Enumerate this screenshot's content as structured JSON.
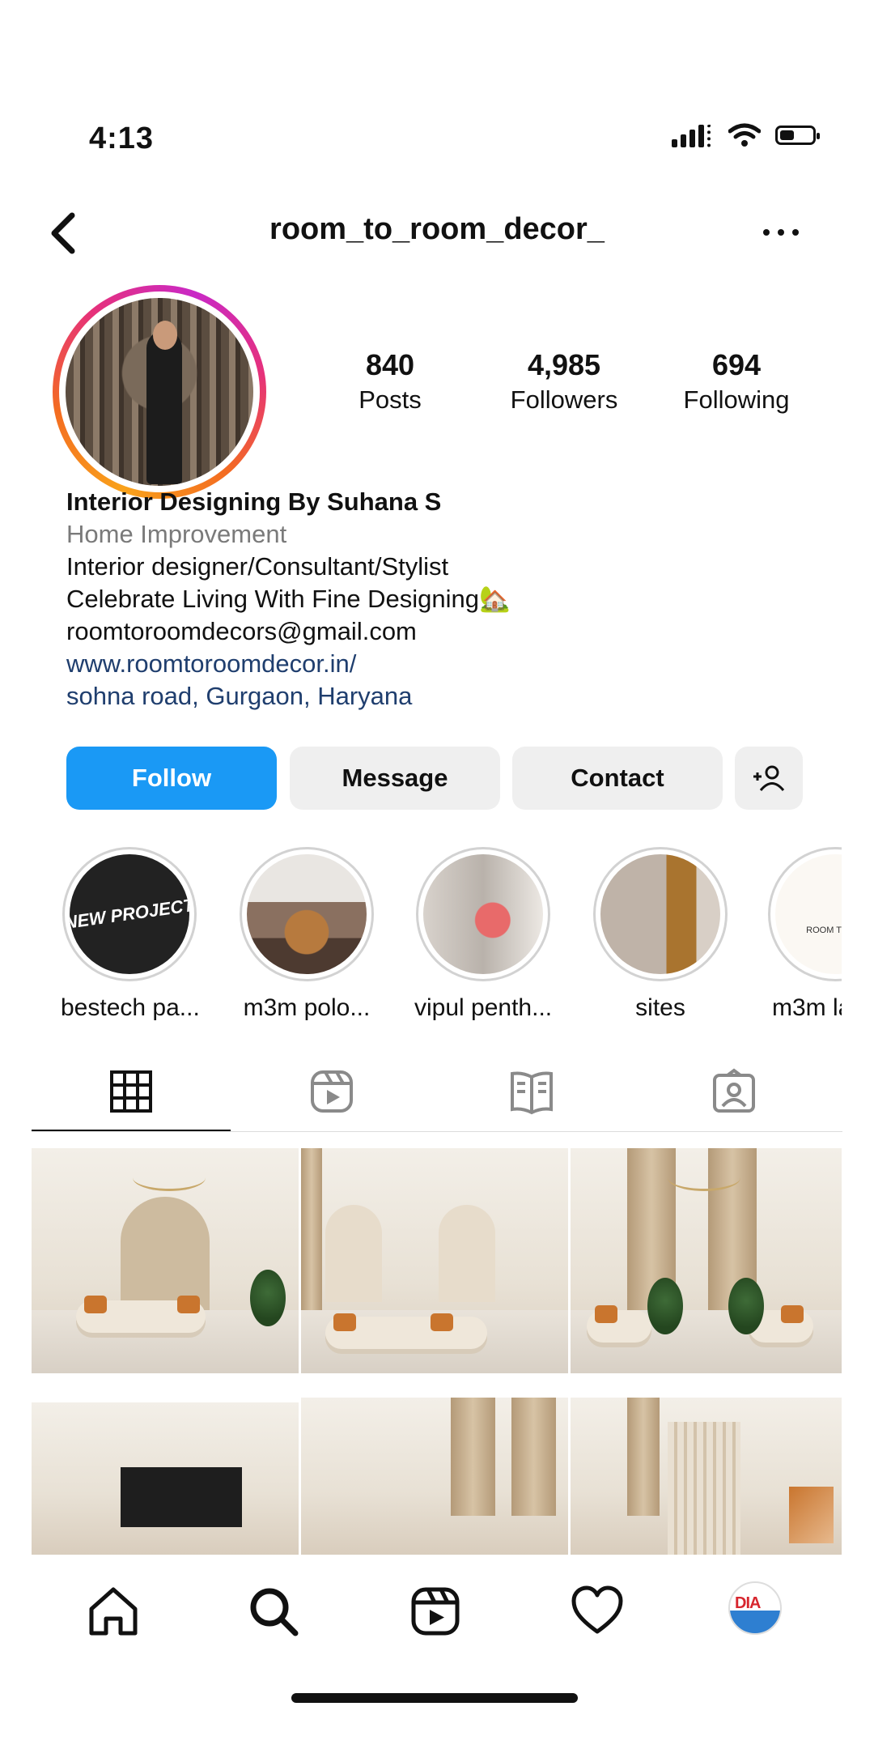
{
  "status_bar": {
    "time": "4:13",
    "battery_level": 0.45
  },
  "header": {
    "username": "room_to_room_decor_"
  },
  "stats": {
    "posts": {
      "count": "840",
      "label": "Posts"
    },
    "followers": {
      "count": "4,985",
      "label": "Followers"
    },
    "following": {
      "count": "694",
      "label": "Following"
    }
  },
  "bio": {
    "name": "Interior Designing By Suhana S",
    "category": "Home Improvement",
    "line1": "Interior designer/Consultant/Stylist",
    "line2": "Celebrate Living With Fine Designing🏡",
    "email": "roomtoroomdecors@gmail.com",
    "website": "www.roomtoroomdecor.in/",
    "location": "sohna road, Gurgaon, Haryana"
  },
  "actions": {
    "follow": "Follow",
    "message": "Message",
    "contact": "Contact"
  },
  "highlights": [
    {
      "label": "bestech pa...",
      "image_text": "NEW PROJECT"
    },
    {
      "label": "m3m polo..."
    },
    {
      "label": "vipul penth..."
    },
    {
      "label": "sites"
    },
    {
      "label": "m3m la",
      "image_text": "ROOM TO RO"
    }
  ],
  "colors": {
    "primary_blue": "#1a99f5",
    "link_blue": "#1f3e6e",
    "secondary_gray": "#efefef",
    "category_gray": "#7a7a7a"
  },
  "icons": {
    "back": "chevron-left-icon",
    "more": "more-icon",
    "add_user": "add-user-icon",
    "tabs": [
      "grid-icon",
      "reels-icon",
      "guides-icon",
      "tagged-icon"
    ],
    "nav": [
      "home-icon",
      "search-icon",
      "reels-icon",
      "heart-icon",
      "profile-avatar"
    ]
  }
}
